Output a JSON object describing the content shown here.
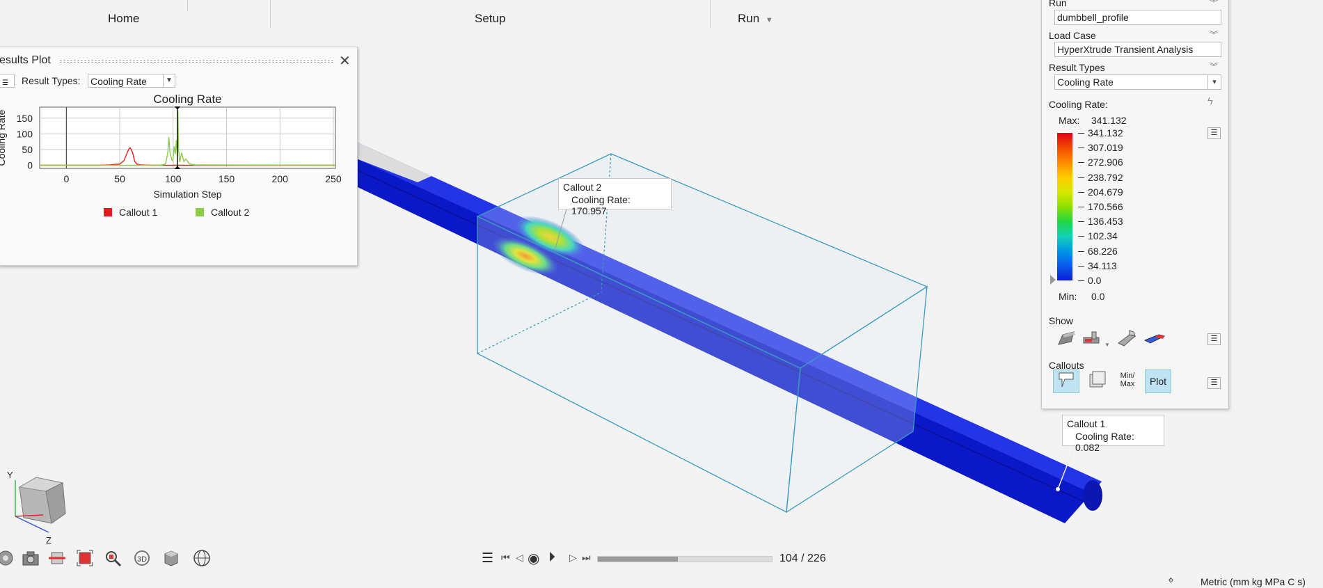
{
  "menu": {
    "home": "Home",
    "setup": "Setup",
    "run": "Run"
  },
  "plot": {
    "title": "esults Plot",
    "result_types_label": "Result Types:",
    "result_type_value": "Cooling Rate",
    "chart_data": {
      "type": "line",
      "title": "Cooling Rate",
      "xlabel": "Simulation Step",
      "ylabel": "Cooling Rate",
      "xlim": [
        -25,
        252
      ],
      "ylim": [
        -10,
        185
      ],
      "xticks": [
        0,
        50,
        100,
        150,
        200,
        250
      ],
      "yticks": [
        0,
        50,
        100,
        150
      ],
      "current_step": 104,
      "series": [
        {
          "name": "Callout 1",
          "color": "#e8191d",
          "x": [
            -25,
            30,
            40,
            50,
            54,
            57,
            59,
            60,
            62,
            64,
            66,
            70,
            80,
            95,
            120,
            252
          ],
          "y": [
            0,
            0,
            1,
            4,
            15,
            40,
            55,
            55,
            40,
            12,
            4,
            1,
            0,
            0,
            0,
            0
          ]
        },
        {
          "name": "Callout 2",
          "color": "#8ccc4a",
          "x": [
            -25,
            85,
            90,
            93,
            95,
            96,
            97,
            99,
            100,
            101,
            102,
            103,
            104,
            104.5,
            105,
            106,
            107,
            108,
            110,
            112,
            115,
            120,
            252
          ],
          "y": [
            0,
            0,
            1,
            5,
            40,
            90,
            40,
            15,
            20,
            60,
            35,
            80,
            30,
            171,
            60,
            10,
            25,
            40,
            12,
            20,
            5,
            1,
            0
          ]
        }
      ]
    }
  },
  "callout1": {
    "title": "Callout 1",
    "text": "Cooling Rate: 0.082"
  },
  "callout2": {
    "title": "Callout 2",
    "text": "Cooling Rate: 170.957"
  },
  "panel": {
    "run_label": "Run",
    "run_value": "dumbbell_profile",
    "loadcase_label": "Load Case",
    "loadcase_value": "HyperXtrude Transient Analysis",
    "resulttypes_label": "Result Types",
    "resulttypes_value": "Cooling Rate",
    "legend_title": "Cooling Rate:",
    "max_label": "Max:",
    "max_value": "341.132",
    "min_label": "Min:",
    "min_value": "0.0",
    "legend_values": [
      "341.132",
      "307.019",
      "272.906",
      "238.792",
      "204.679",
      "170.566",
      "136.453",
      "102.34",
      "68.226",
      "34.113",
      "0.0"
    ],
    "legend_colors": [
      "#e0001b",
      "#f24a00",
      "#ff8a00",
      "#ffcc00",
      "#d8e800",
      "#8ee000",
      "#22d640",
      "#14d2b4",
      "#0096e6",
      "#0a5aeb",
      "#0a1ed8"
    ],
    "show_label": "Show",
    "callouts_label": "Callouts",
    "minmax_label": "Min/ Max",
    "plot_label": "Plot"
  },
  "playback": {
    "frame": "104 / 226",
    "progress": 0.46
  },
  "units": "Metric (mm kg MPa C s)"
}
